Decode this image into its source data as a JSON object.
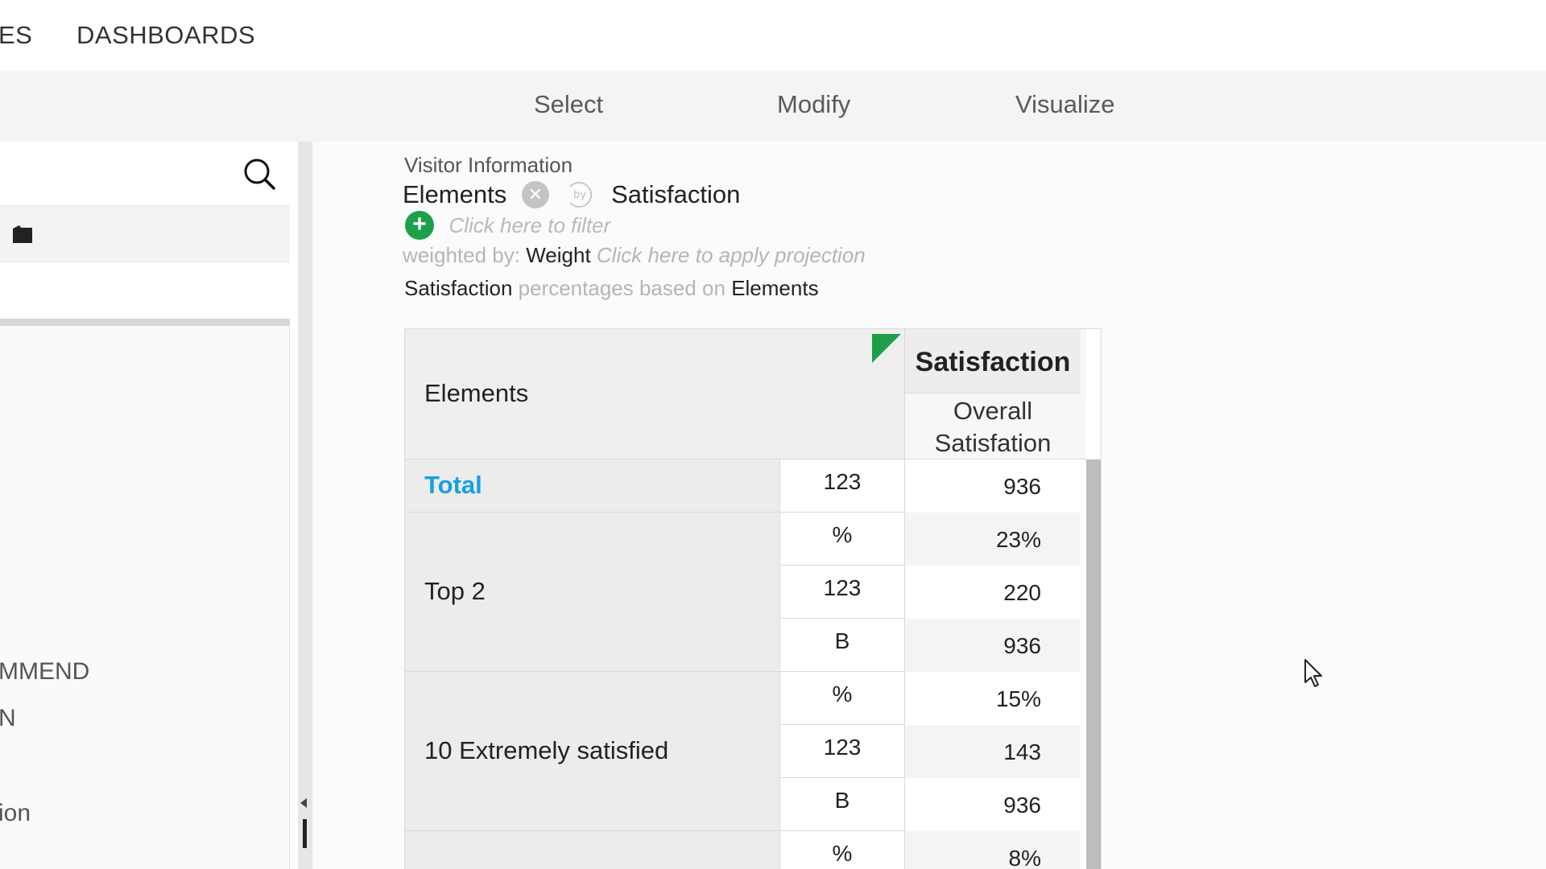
{
  "topnav": {
    "item_partial": "ES",
    "item_dashboards": "DASHBOARDS"
  },
  "toolbar": {
    "select": "Select",
    "modify": "Modify",
    "visualize": "Visualize"
  },
  "sidebar": {
    "items": [
      "MMEND",
      "N",
      "ion"
    ]
  },
  "query": {
    "context": "Visitor Information",
    "row_var": "Elements",
    "col_var": "Satisfaction",
    "filter_prompt": "Click here to filter",
    "weighted_by_label": "weighted by:",
    "weight": "Weight",
    "projection_prompt": "Click here to apply projection",
    "basis_var": "Satisfaction",
    "basis_text": "percentages based on",
    "basis_base": "Elements"
  },
  "table": {
    "row_header": "Elements",
    "col_var": "Satisfaction",
    "col_sub_line1": "Overall",
    "col_sub_line2": "Satisfation",
    "groups": [
      {
        "label": "Total",
        "rows": [
          {
            "stat": "123",
            "value": "936"
          }
        ]
      },
      {
        "label": "Top 2",
        "rows": [
          {
            "stat": "%",
            "value": "23%"
          },
          {
            "stat": "123",
            "value": "220"
          },
          {
            "stat": "B",
            "value": "936"
          }
        ]
      },
      {
        "label": "10 Extremely satisfied",
        "rows": [
          {
            "stat": "%",
            "value": "15%"
          },
          {
            "stat": "123",
            "value": "143"
          },
          {
            "stat": "B",
            "value": "936"
          }
        ]
      },
      {
        "label": "",
        "rows": [
          {
            "stat": "%",
            "value": "8%"
          }
        ]
      }
    ]
  },
  "colors": {
    "accent_green": "#1ea04b",
    "total_blue": "#1aa0e0"
  },
  "icons": [
    "search-icon",
    "folder-icon",
    "remove-icon",
    "by-icon",
    "add-filter-icon",
    "cursor-icon"
  ]
}
